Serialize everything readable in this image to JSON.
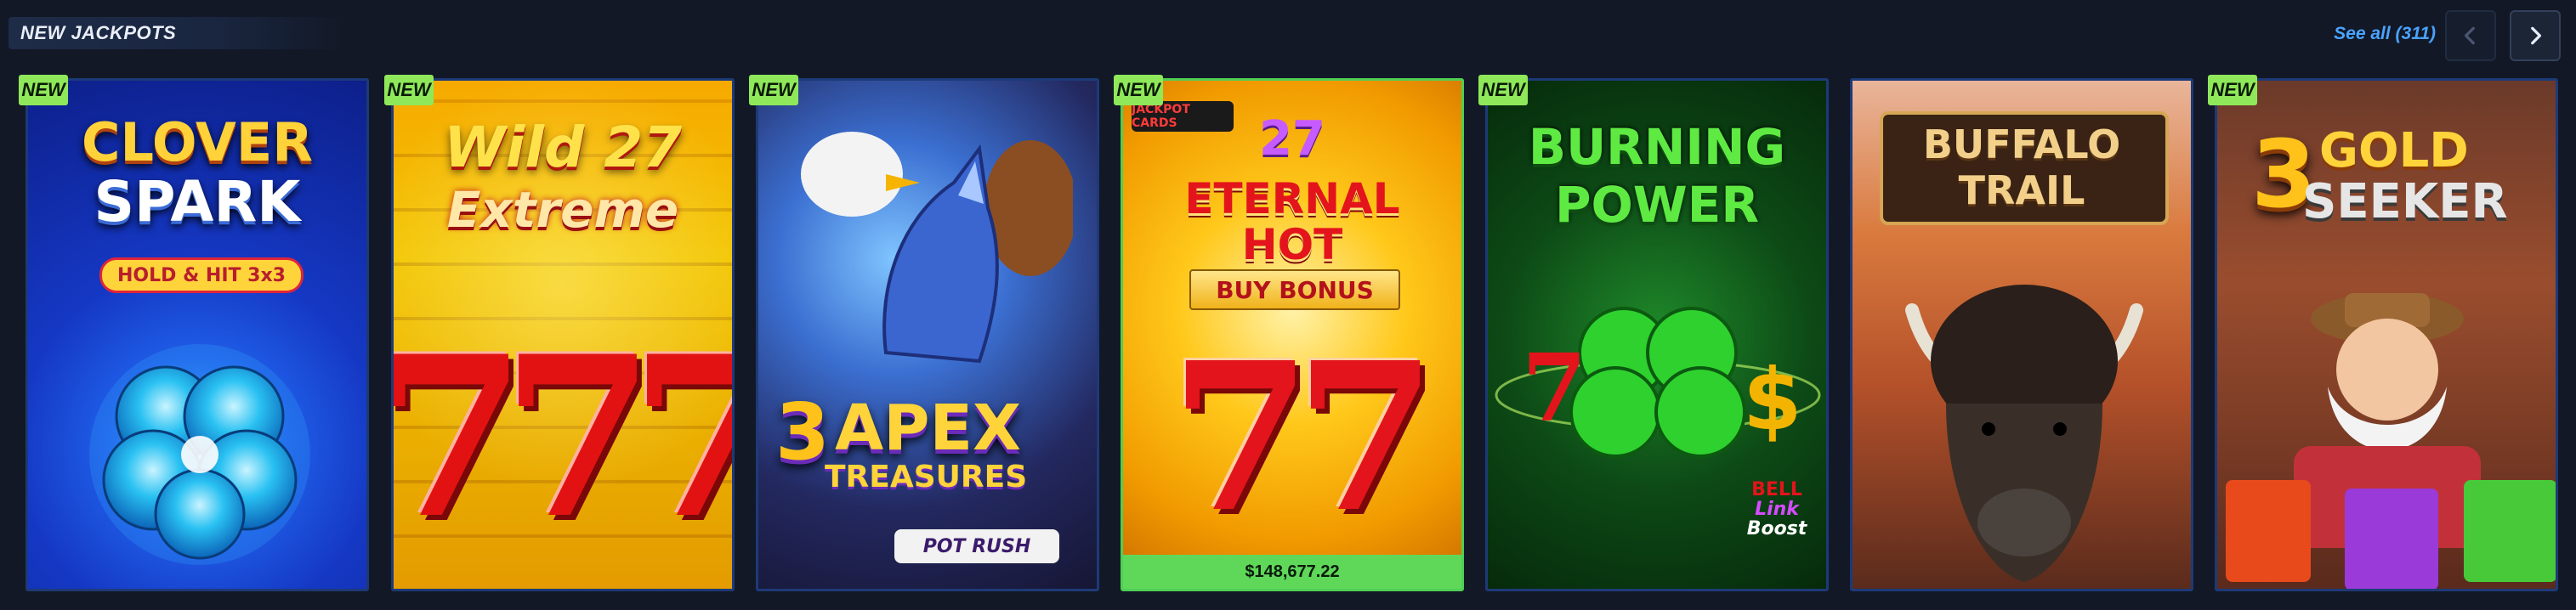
{
  "section": {
    "title": "NEW JACKPOTS",
    "see_all": "See all (311)",
    "prev_icon": "chevron-left-icon",
    "next_icon": "chevron-right-icon"
  },
  "badge_label": "NEW",
  "games": [
    {
      "title_line1": "CLOVER",
      "title_line2": "SPARK",
      "subtitle": "HOLD & HIT 3x3",
      "new": true
    },
    {
      "title_line1": "Wild 27",
      "title_line2": "Extreme",
      "new": true
    },
    {
      "title_line1": "3",
      "title_line2": "APEX",
      "title_line3": "TREASURES",
      "provider": "POT RUSH",
      "new": true
    },
    {
      "brand": "JACKPOT CARDS",
      "title_line1": "27",
      "title_line2": "ETERNAL",
      "title_line3": "HOT",
      "subtitle": "BUY BONUS",
      "jackpot": "$148,677.22",
      "new": true
    },
    {
      "title_line1": "BURNING",
      "title_line2": "POWER",
      "subtitle_a": "BELL",
      "subtitle_b": "Link",
      "subtitle_c": "Boost",
      "new": true
    },
    {
      "title_line1": "BUFFALO",
      "title_line2": "TRAIL",
      "new": false
    },
    {
      "title_line1": "3",
      "title_line2": "GOLD",
      "title_line3": "SEEKER",
      "new": true
    }
  ],
  "colors": {
    "background": "#121826",
    "accent_blue": "#4aa3ff",
    "badge_green": "#8fe85a",
    "card_border": "#1d3a78"
  }
}
